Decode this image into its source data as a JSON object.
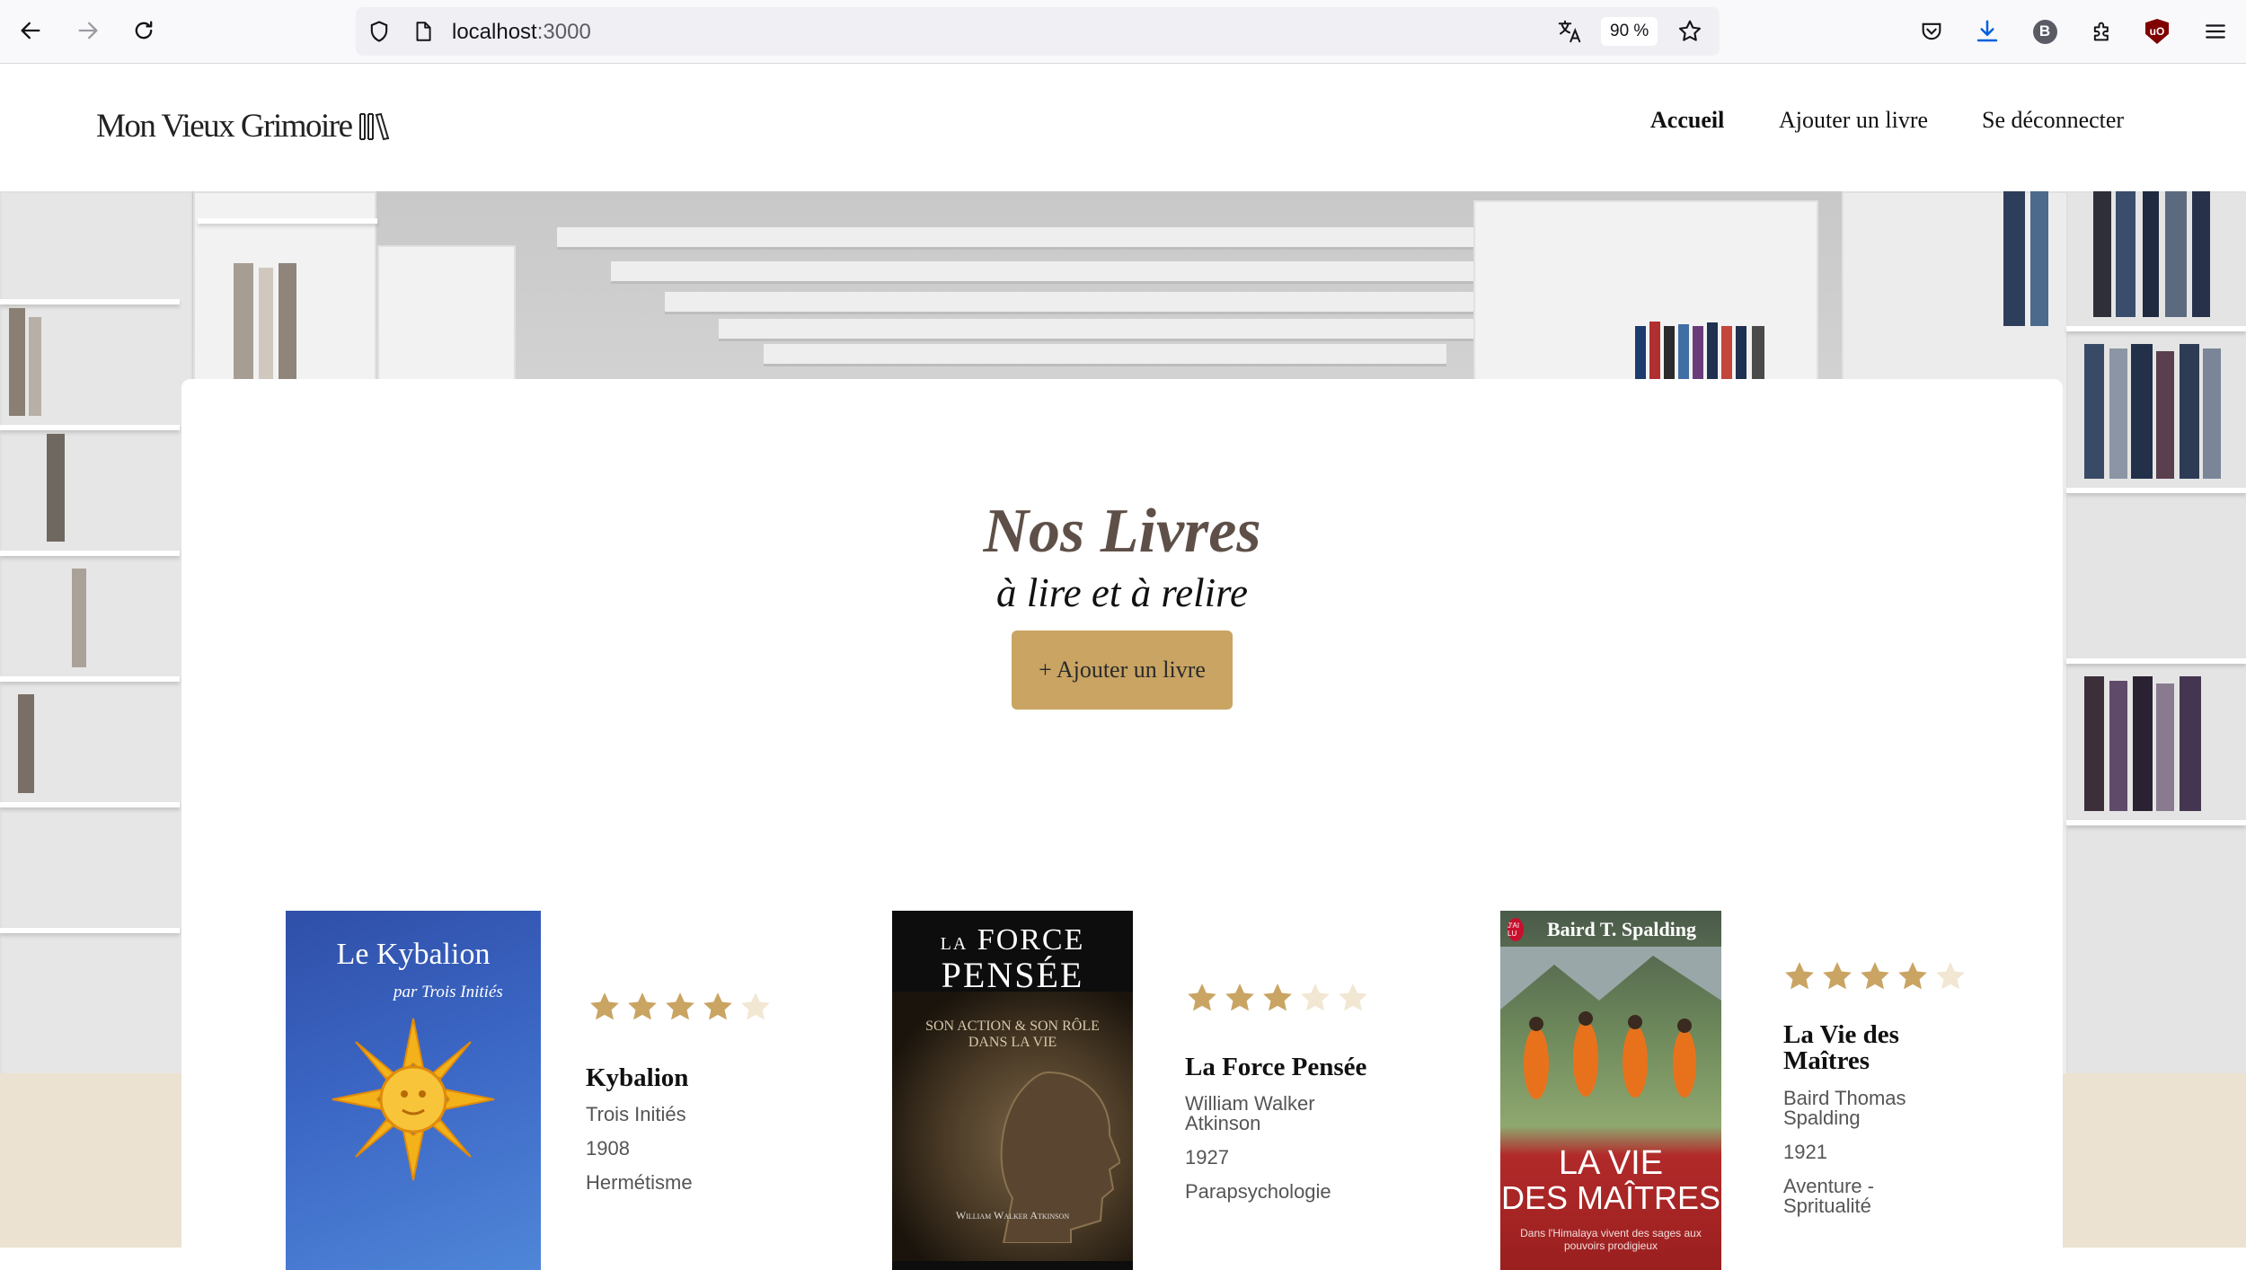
{
  "browser": {
    "url_host": "localhost",
    "url_port": ":3000",
    "zoom": "90 %",
    "profile_initial": "B",
    "ublock_label": "uO"
  },
  "site": {
    "logo_text": "Mon Vieux Grimoire",
    "nav": [
      {
        "label": "Accueil",
        "active": true
      },
      {
        "label": "Ajouter un livre",
        "active": false
      },
      {
        "label": "Se déconnecter",
        "active": false
      }
    ]
  },
  "main": {
    "title": "Nos Livres",
    "subtitle": "à lire et à relire",
    "add_button_label": "+ Ajouter un livre"
  },
  "books": [
    {
      "title": "Kybalion",
      "author": "Trois Initiés",
      "year": "1908",
      "genre": "Hermétisme",
      "rating": 4,
      "cover_title": "Le Kybalion",
      "cover_subtitle": "par Trois Initiés"
    },
    {
      "title": "La Force Pensée",
      "author": "William Walker Atkinson",
      "year": "1927",
      "genre": "Parapsychologie",
      "rating": 3,
      "cover_title_small": "LA",
      "cover_title_1": "FORCE",
      "cover_title_2": "PENSÉE",
      "cover_subtitle": "SON ACTION & SON RÔLE DANS LA VIE",
      "cover_author": "William Walker Atkinson"
    },
    {
      "title": "La Vie des Maîtres",
      "author": "Baird Thomas Spalding",
      "year": "1921",
      "genre": "Aventure - Spritualité",
      "rating": 4,
      "cover_author": "Baird T. Spalding",
      "cover_title_1": "LA VIE",
      "cover_title_2": "DES MAÎTRES",
      "cover_tagline": "Dans l'Himalaya vivent des sages aux pouvoirs prodigieux",
      "cover_publisher": "J'AI LU"
    }
  ],
  "colors": {
    "accent": "#c9a463",
    "star_filled": "#c9a463",
    "star_empty": "#f1e7d2",
    "title_brown": "#5e5048",
    "cream": "#ebe2d1"
  }
}
